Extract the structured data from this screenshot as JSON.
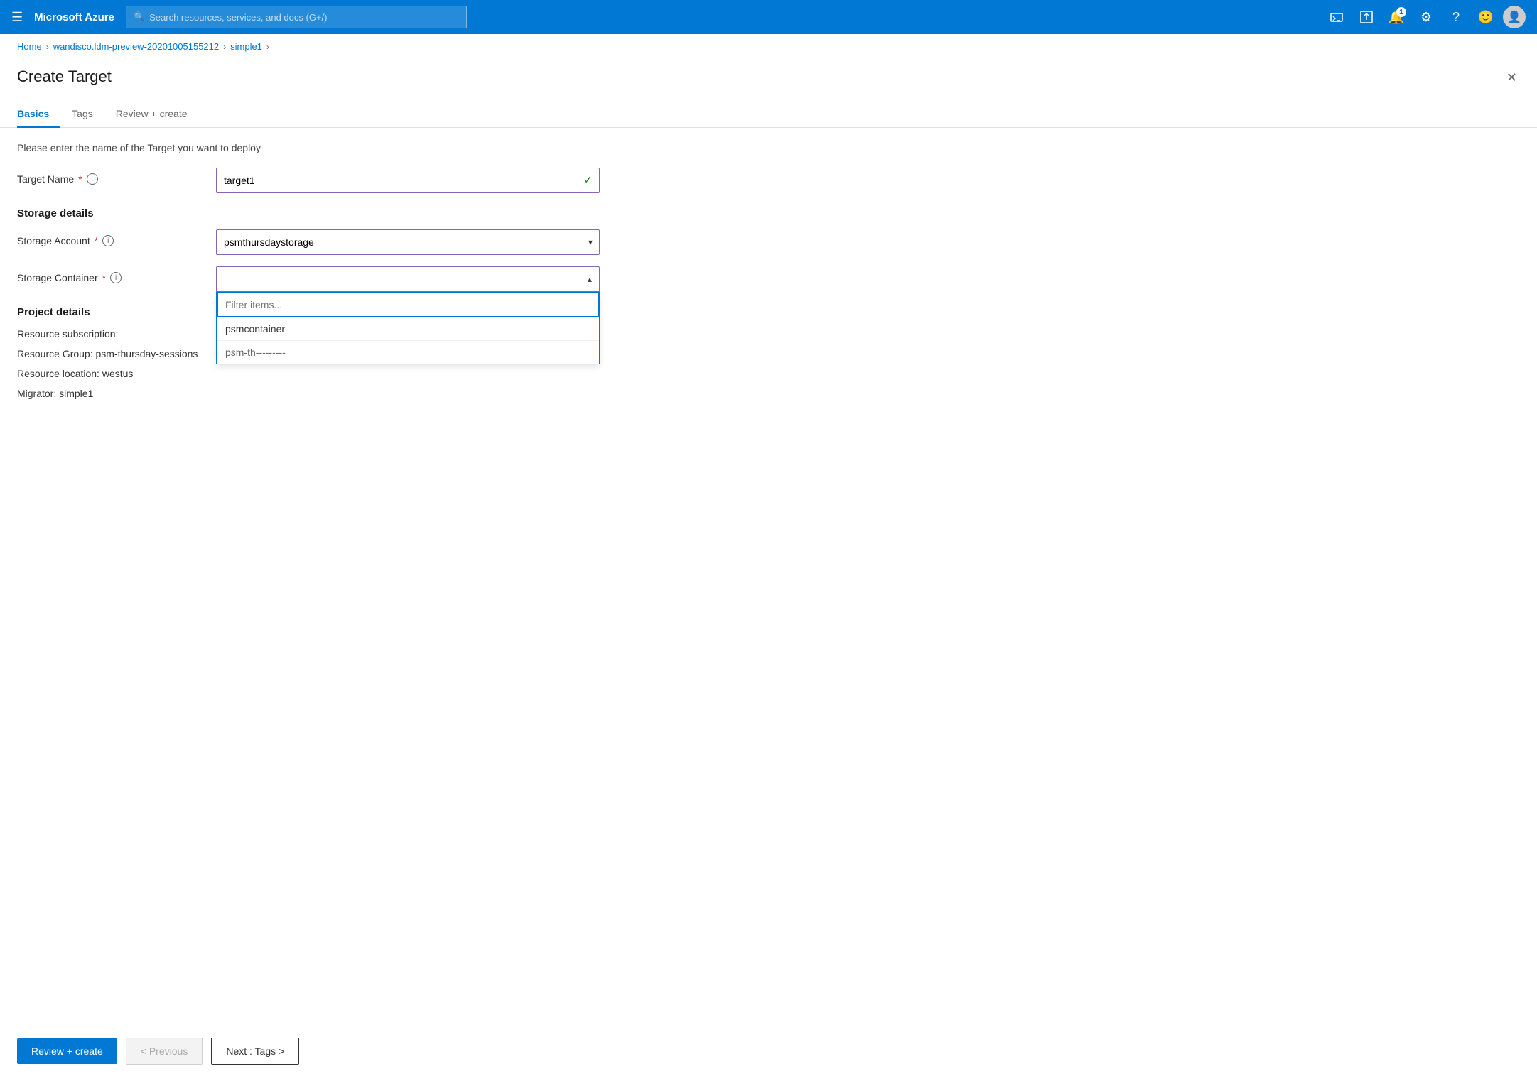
{
  "topnav": {
    "menu_icon": "☰",
    "brand": "Microsoft Azure",
    "search_placeholder": "Search resources, services, and docs (G+/)",
    "notification_count": "1",
    "icons": [
      {
        "name": "cloud-shell-icon",
        "symbol": "⬛"
      },
      {
        "name": "feedback-icon",
        "symbol": "⧉"
      },
      {
        "name": "notifications-icon",
        "symbol": "🔔"
      },
      {
        "name": "settings-icon",
        "symbol": "⚙"
      },
      {
        "name": "help-icon",
        "symbol": "?"
      },
      {
        "name": "smiley-icon",
        "symbol": "🙂"
      }
    ]
  },
  "breadcrumb": {
    "items": [
      {
        "label": "Home",
        "href": "#"
      },
      {
        "label": "wandisco.ldm-preview-20201005155212",
        "href": "#"
      },
      {
        "label": "simple1",
        "href": "#"
      }
    ]
  },
  "panel": {
    "title": "Create Target",
    "close_label": "✕"
  },
  "tabs": [
    {
      "id": "basics",
      "label": "Basics",
      "active": true
    },
    {
      "id": "tags",
      "label": "Tags",
      "active": false
    },
    {
      "id": "review",
      "label": "Review + create",
      "active": false
    }
  ],
  "form": {
    "description": "Please enter the name of the Target you want to deploy",
    "target_name_label": "Target Name",
    "target_name_value": "target1",
    "storage_section": "Storage details",
    "storage_account_label": "Storage Account",
    "storage_account_value": "psmthursdaystorage",
    "storage_container_label": "Storage Container",
    "storage_container_value": "",
    "filter_placeholder": "Filter items...",
    "dropdown_items": [
      "psmcontainer"
    ],
    "dropdown_partial": "psm-th---------",
    "project_section": "Project details",
    "resource_subscription_label": "Resource subscription:",
    "resource_group_label": "Resource Group: psm-thursday-sessions",
    "resource_location_label": "Resource location: westus",
    "migrator_label": "Migrator: simple1"
  },
  "footer": {
    "review_create_label": "Review + create",
    "previous_label": "< Previous",
    "next_label": "Next : Tags >"
  }
}
